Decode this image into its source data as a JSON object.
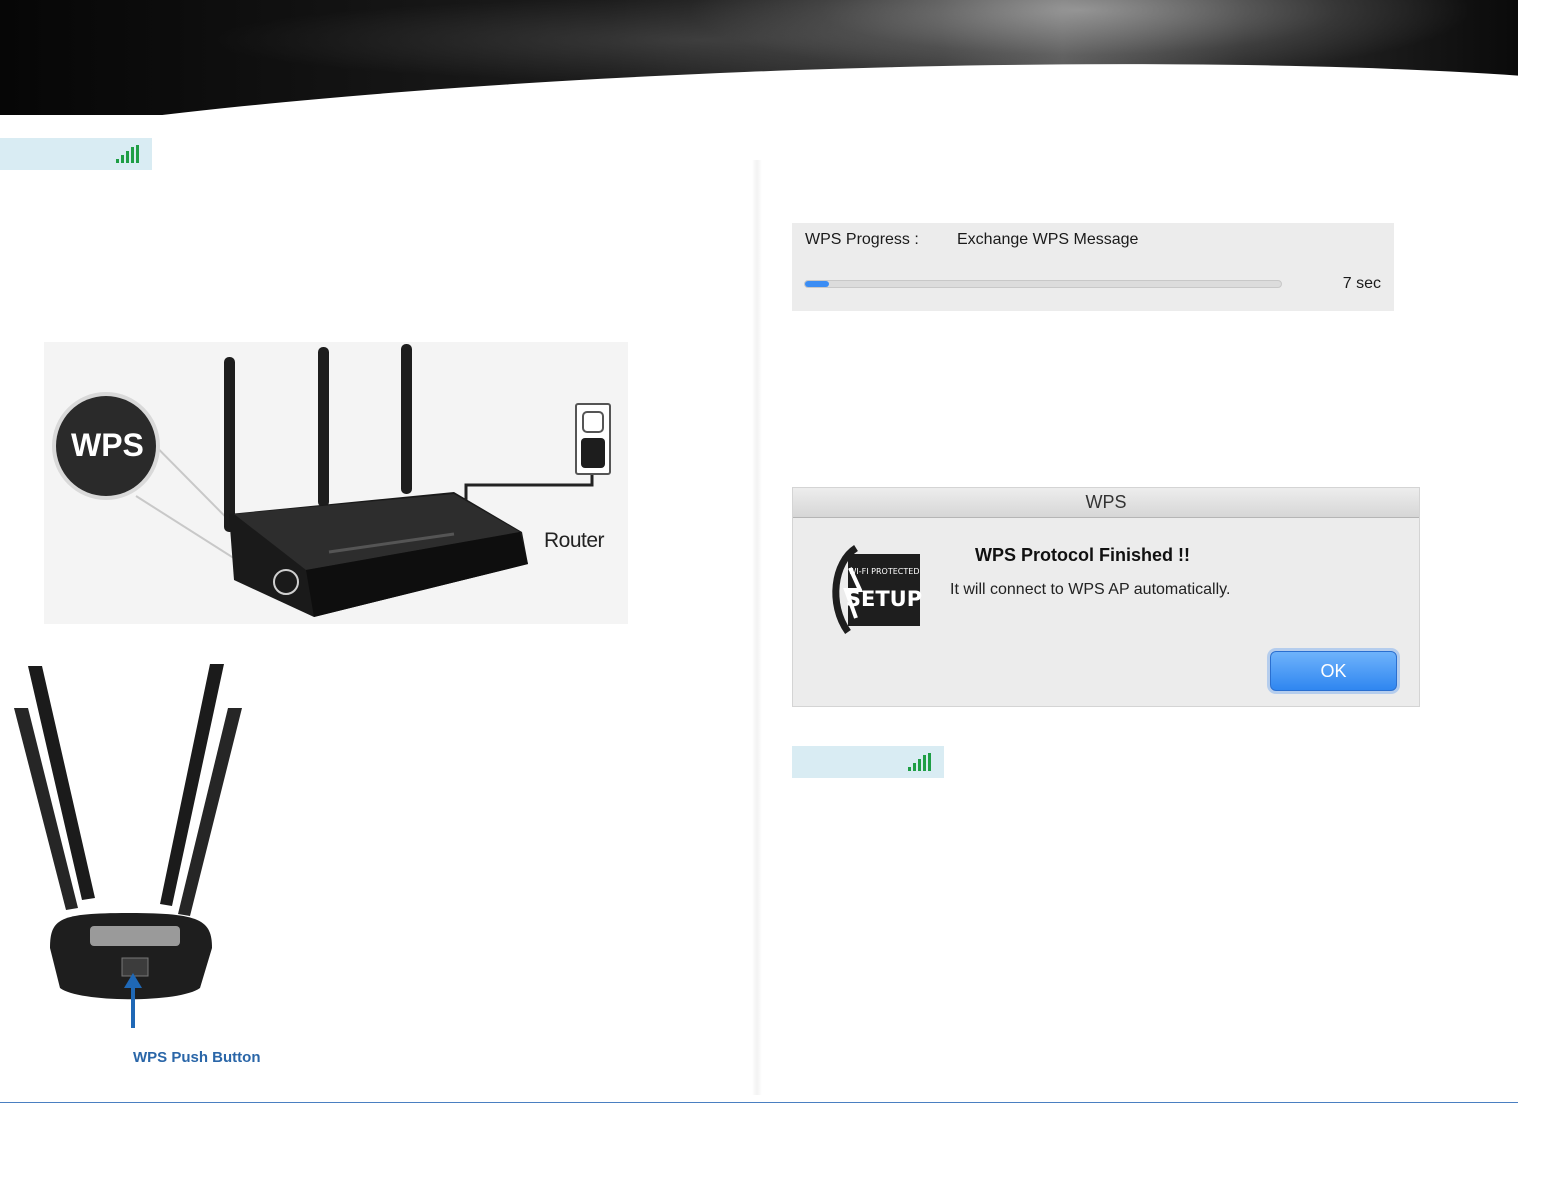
{
  "signal_indicators": [
    {
      "name": "signal-strength-top-left",
      "icon": "signal-bars-icon",
      "bars": 4,
      "color": "#1e9e45"
    },
    {
      "name": "signal-strength-right",
      "icon": "signal-bars-icon",
      "bars": 4,
      "color": "#1e9e45"
    }
  ],
  "router_figure": {
    "badge_text": "WPS",
    "device_label": "Router"
  },
  "adapter_figure": {
    "caption": "WPS Push Button"
  },
  "wps_progress": {
    "label": "WPS Progress :",
    "status": "Exchange WPS Message",
    "remaining": "7 sec",
    "progress_fraction": 0.05,
    "fill_color": "#3b8df4"
  },
  "dialog": {
    "title": "WPS",
    "heading": "WPS Protocol Finished !!",
    "message": "It will connect to WPS AP automatically.",
    "ok_label": "OK",
    "logo_text_top": "WI-FI PROTECTED",
    "logo_text_main": "SETUP"
  },
  "colors": {
    "accent_blue": "#2a66a8",
    "footer_rule": "#4a7fc1"
  }
}
